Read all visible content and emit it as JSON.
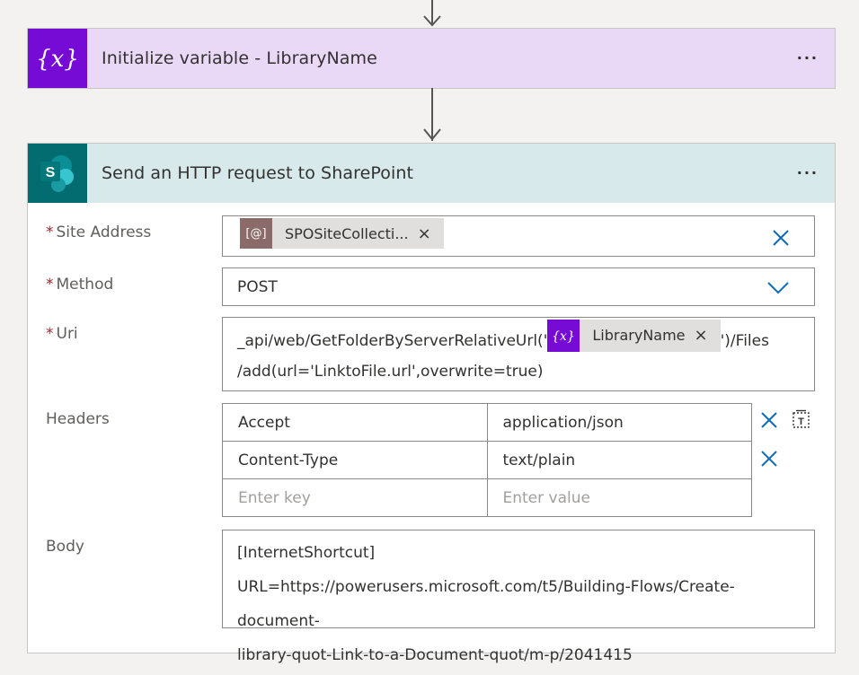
{
  "init_variable": {
    "title": "Initialize variable - LibraryName",
    "icon": "variable-icon",
    "more": "···"
  },
  "http_request": {
    "title": "Send an HTTP request to SharePoint",
    "icon": "sharepoint-icon",
    "more": "···",
    "site_address": {
      "label": "Site Address",
      "token_icon": "[@]",
      "token_label": "SPOSiteCollecti...",
      "token_close": "×"
    },
    "method": {
      "label": "Method",
      "value": "POST"
    },
    "uri": {
      "label": "Uri",
      "prefix": "_api/web/GetFolderByServerRelativeUrl('",
      "token_label": "LibraryName",
      "token_close": "×",
      "suffix": "')/Files",
      "line2": "/add(url='LinktoFile.url',overwrite=true)"
    },
    "headers": {
      "label": "Headers",
      "rows": [
        {
          "key": "Accept",
          "value": "application/json"
        },
        {
          "key": "Content-Type",
          "value": "text/plain"
        }
      ],
      "key_placeholder": "Enter key",
      "value_placeholder": "Enter value"
    },
    "body": {
      "label": "Body",
      "lines": [
        "[InternetShortcut]",
        "URL=https://powerusers.microsoft.com/t5/Building-Flows/Create-document-",
        "library-quot-Link-to-a-Document-quot/m-p/2041415"
      ]
    }
  },
  "colors": {
    "variable_accent": "#770bd6",
    "sharepoint_accent": "#036c70",
    "link_blue": "#0f6cbd",
    "required_red": "#a4262c"
  }
}
